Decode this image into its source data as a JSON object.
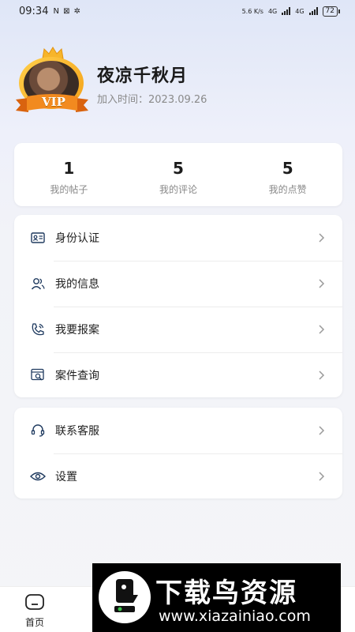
{
  "status_bar": {
    "time": "09:34",
    "indicators": "N ⊠ ✲",
    "network_speed": "5.6 K/s",
    "signal1": "4G",
    "signal2": "4G",
    "battery": "72"
  },
  "profile": {
    "vip_badge": "VIP",
    "username": "夜凉千秋月",
    "join_date": "加入时间：2023.09.26"
  },
  "stats": [
    {
      "value": "1",
      "label": "我的帖子"
    },
    {
      "value": "5",
      "label": "我的评论"
    },
    {
      "value": "5",
      "label": "我的点赞"
    }
  ],
  "menu_group_1": [
    {
      "label": "身份认证",
      "icon": "id-card-icon"
    },
    {
      "label": "我的信息",
      "icon": "users-icon"
    },
    {
      "label": "我要报案",
      "icon": "phone-icon"
    },
    {
      "label": "案件查询",
      "icon": "search-doc-icon"
    }
  ],
  "menu_group_2": [
    {
      "label": "联系客服",
      "icon": "headset-icon"
    },
    {
      "label": "设置",
      "icon": "eye-settings-icon"
    }
  ],
  "tab_bar": {
    "home_label": "首页"
  },
  "watermark": {
    "title": "下载鸟资源",
    "url": "www.xiazainiao.com"
  },
  "colors": {
    "accent_icon": "#1f3a5f",
    "vip_gold": "#f4a21a",
    "vip_ribbon": "#f07a1a"
  }
}
